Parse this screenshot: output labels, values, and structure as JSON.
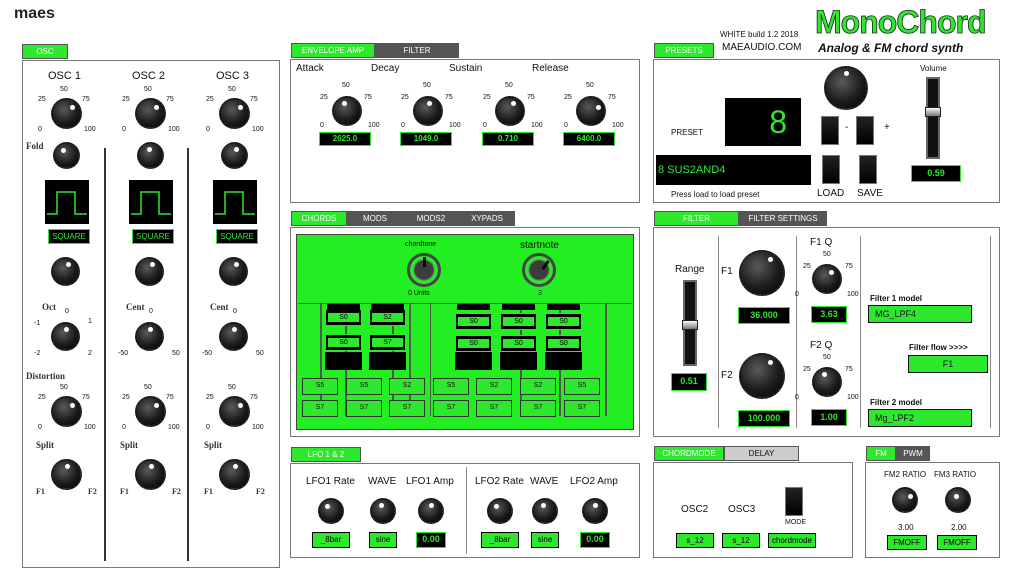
{
  "brand": {
    "logo": "maes",
    "build": "WHITE build  1.2 2018",
    "site": "MAEAUDIO.COM",
    "title": "MonoChord",
    "subtitle": "Analog & FM chord synth"
  },
  "osc": {
    "tab": "OSC",
    "columns": [
      {
        "title": "OSC 1",
        "wave": "SQUARE",
        "mod_label": "Oct",
        "mod_min": "-1",
        "mod_mid": "0",
        "mod_max": "1",
        "mod_lo": "-2",
        "mod_hi": "2"
      },
      {
        "title": "OSC 2",
        "wave": "SQUARE",
        "mod_label": "Cent",
        "mod_min": "",
        "mod_mid": "0",
        "mod_max": "",
        "mod_lo": "-50",
        "mod_hi": "50"
      },
      {
        "title": "OSC 3",
        "wave": "SQUARE",
        "mod_label": "Cent",
        "mod_min": "",
        "mod_mid": "0",
        "mod_max": "",
        "mod_lo": "-50",
        "mod_hi": "50"
      }
    ],
    "fold_label": "Fold",
    "distortion_label": "Distortion",
    "split_label": "Split",
    "split_lo": "F1",
    "split_hi": "F2",
    "scale": {
      "s0": "0",
      "s25": "25",
      "s50": "50",
      "s75": "75",
      "s100": "100"
    }
  },
  "envelope": {
    "tabs": [
      "ENVELOPE AMP",
      "FILTER"
    ],
    "knobs": [
      {
        "label": "Attack",
        "value": "2625.0"
      },
      {
        "label": "Decay",
        "value": "1049.0"
      },
      {
        "label": "Sustain",
        "value": "0.710"
      },
      {
        "label": "Release",
        "value": "6400.0"
      }
    ]
  },
  "chords": {
    "tabs": [
      "CHORDS",
      "MODS",
      "MODS2",
      "XYPADS"
    ],
    "chordtone_label": "chordtone",
    "chordtone_value": "0 Units",
    "startnote_label": "startnote",
    "startnote_value": "3",
    "top_slots": [
      [
        "S0",
        "S2"
      ],
      [
        "S0",
        "S7"
      ],
      [
        "S0",
        "S0",
        "S0"
      ],
      [
        "S0",
        "S0",
        "S0"
      ]
    ],
    "bottom_row1": [
      "S5",
      "S5",
      "S2",
      "S5",
      "S2",
      "S2",
      "S5"
    ],
    "bottom_row2": [
      "S7",
      "S7",
      "S7",
      "S7",
      "S7",
      "S7",
      "S7"
    ]
  },
  "lfo": {
    "tab": "LFO  1 & 2",
    "labels": [
      "LFO1 Rate",
      "WAVE",
      "LFO1 Amp",
      "LFO2 Rate",
      "WAVE",
      "LFO2 Amp"
    ],
    "values": [
      "_8bar",
      "sine",
      "0.00",
      "_8bar",
      "sine",
      "0.00"
    ]
  },
  "presets": {
    "tab": "PRESETS",
    "preset_label": "PRESET",
    "preset_number": "8",
    "preset_name": "8 SUS2AND4",
    "minus": "-",
    "plus": "+",
    "hint": "Press load to load preset",
    "load": "LOAD",
    "save": "SAVE",
    "volume_label": "Volume",
    "volume_value": "0.59",
    "volume_level": 0.59
  },
  "filter": {
    "tabs": [
      "FILTER",
      "FILTER SETTINGS"
    ],
    "range_label": "Range",
    "range_value": "0.51",
    "f1_label": "F1",
    "f1_value": "36.000",
    "f2_label": "F2",
    "f2_value": "100.000",
    "f1q_label": "F1 Q",
    "f1q_value": "3.63",
    "f2q_label": "F2 Q",
    "f2q_value": "1.00",
    "model1_label": "Filter 1 model",
    "model1_value": "MG_LPF4",
    "flow_label": "Filter flow >>>>",
    "flow_value": "F1",
    "model2_label": "Filter 2 model",
    "model2_value": "Mg_LPF2"
  },
  "chordmode": {
    "tabs": [
      "CHORDMODE",
      "DELAY"
    ],
    "osc2_label": "OSC2",
    "osc3_label": "OSC3",
    "mode_label": "MODE",
    "osc2_value": "s_12",
    "osc3_value": "s_12",
    "mode_value": "chordmode"
  },
  "fm": {
    "tabs": [
      "FM",
      "PWM"
    ],
    "fm2_label": "FM2 RATIO",
    "fm3_label": "FM3 RATIO",
    "fm2_value": "3.00",
    "fm3_value": "2.00",
    "fm2_btn": "FMOFF",
    "fm3_btn": "FMOFF"
  },
  "colors": {
    "accent": "#2ee82e",
    "dark": "#000000",
    "panel_border": "#777777"
  }
}
